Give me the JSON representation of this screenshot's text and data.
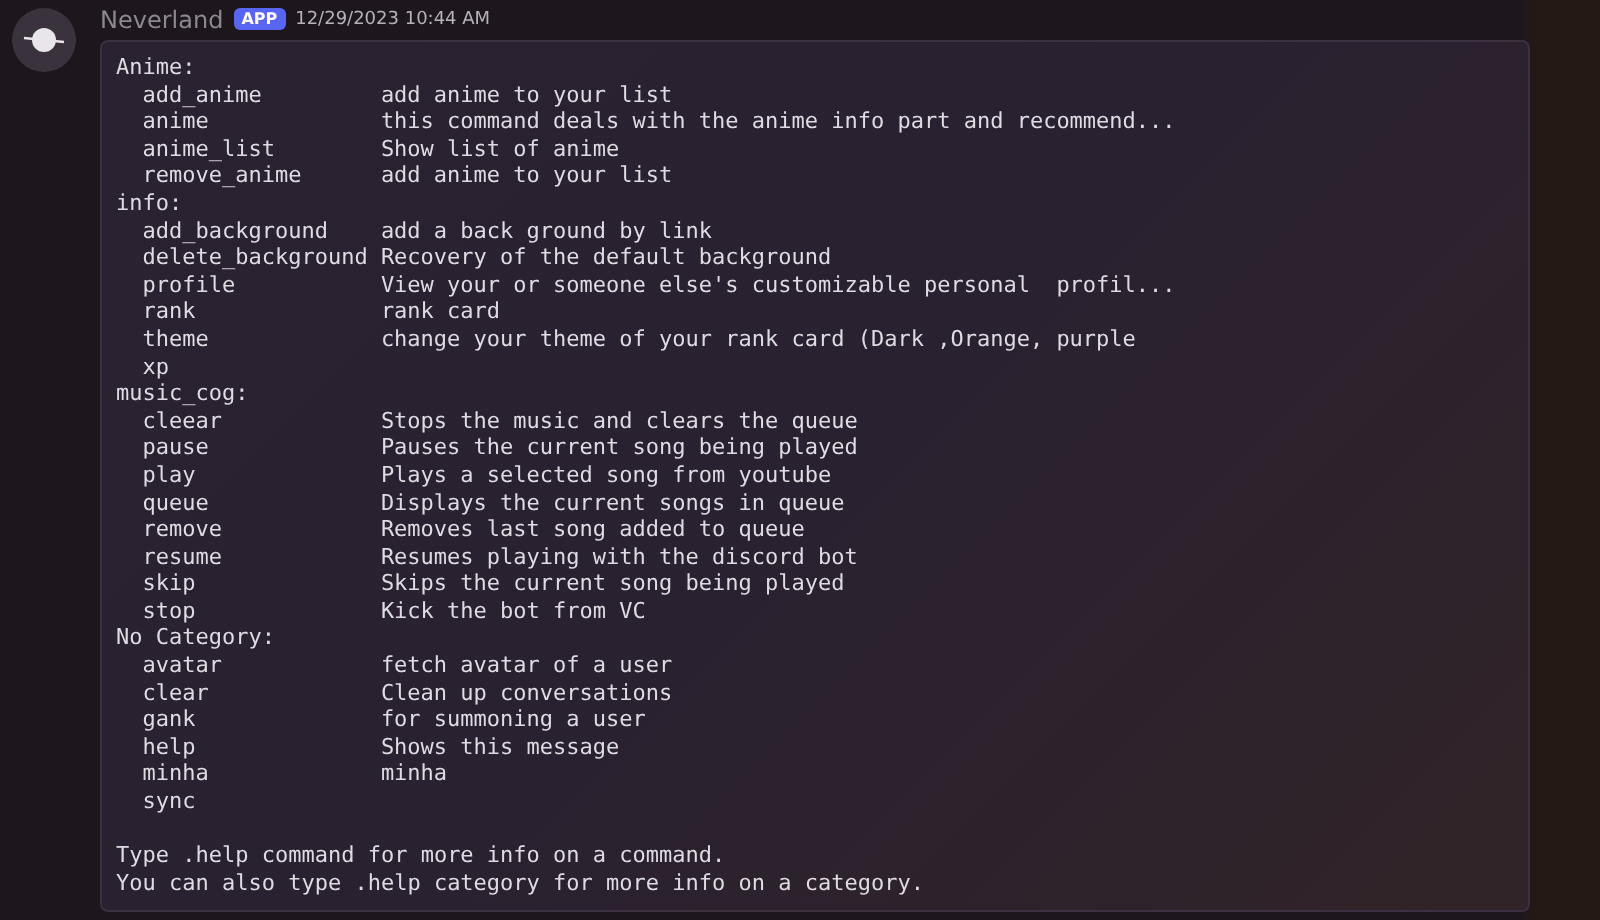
{
  "message": {
    "author": "Neverland",
    "badge": "APP",
    "timestamp": "12/29/2023 10:44 AM"
  },
  "help_block": {
    "sections": [
      {
        "title": "Anime:",
        "commands": [
          {
            "name": "add_anime",
            "description": "add anime to your list"
          },
          {
            "name": "anime",
            "description": "this command deals with the anime info part and recommend..."
          },
          {
            "name": "anime_list",
            "description": "Show list of anime"
          },
          {
            "name": "remove_anime",
            "description": "add anime to your list"
          }
        ]
      },
      {
        "title": "info:",
        "commands": [
          {
            "name": "add_background",
            "description": "add a back ground by link"
          },
          {
            "name": "delete_background",
            "description": "Recovery of the default background"
          },
          {
            "name": "profile",
            "description": "View your or someone else's customizable personal  profil..."
          },
          {
            "name": "rank",
            "description": "rank card"
          },
          {
            "name": "theme",
            "description": "change your theme of your rank card (Dark ,Orange, purple"
          },
          {
            "name": "xp"
          }
        ]
      },
      {
        "title": "music_cog:",
        "commands": [
          {
            "name": "cleear",
            "description": "Stops the music and clears the queue"
          },
          {
            "name": "pause",
            "description": "Pauses the current song being played"
          },
          {
            "name": "play",
            "description": "Plays a selected song from youtube"
          },
          {
            "name": "queue",
            "description": "Displays the current songs in queue"
          },
          {
            "name": "remove",
            "description": "Removes last song added to queue"
          },
          {
            "name": "resume",
            "description": "Resumes playing with the discord bot"
          },
          {
            "name": "skip",
            "description": "Skips the current song being played"
          },
          {
            "name": "stop",
            "description": "Kick the bot from VC"
          }
        ]
      },
      {
        "title": "No Category:",
        "commands": [
          {
            "name": "avatar",
            "description": "fetch avatar of a user"
          },
          {
            "name": "clear",
            "description": "Clean up conversations"
          },
          {
            "name": "gank",
            "description": "for summoning a user"
          },
          {
            "name": "help",
            "description": "Shows this message"
          },
          {
            "name": "minha",
            "description": "minha"
          },
          {
            "name": "sync"
          }
        ]
      }
    ],
    "footer": [
      "Type .help command for more info on a command.",
      "You can also type .help category for more info on a category."
    ]
  }
}
